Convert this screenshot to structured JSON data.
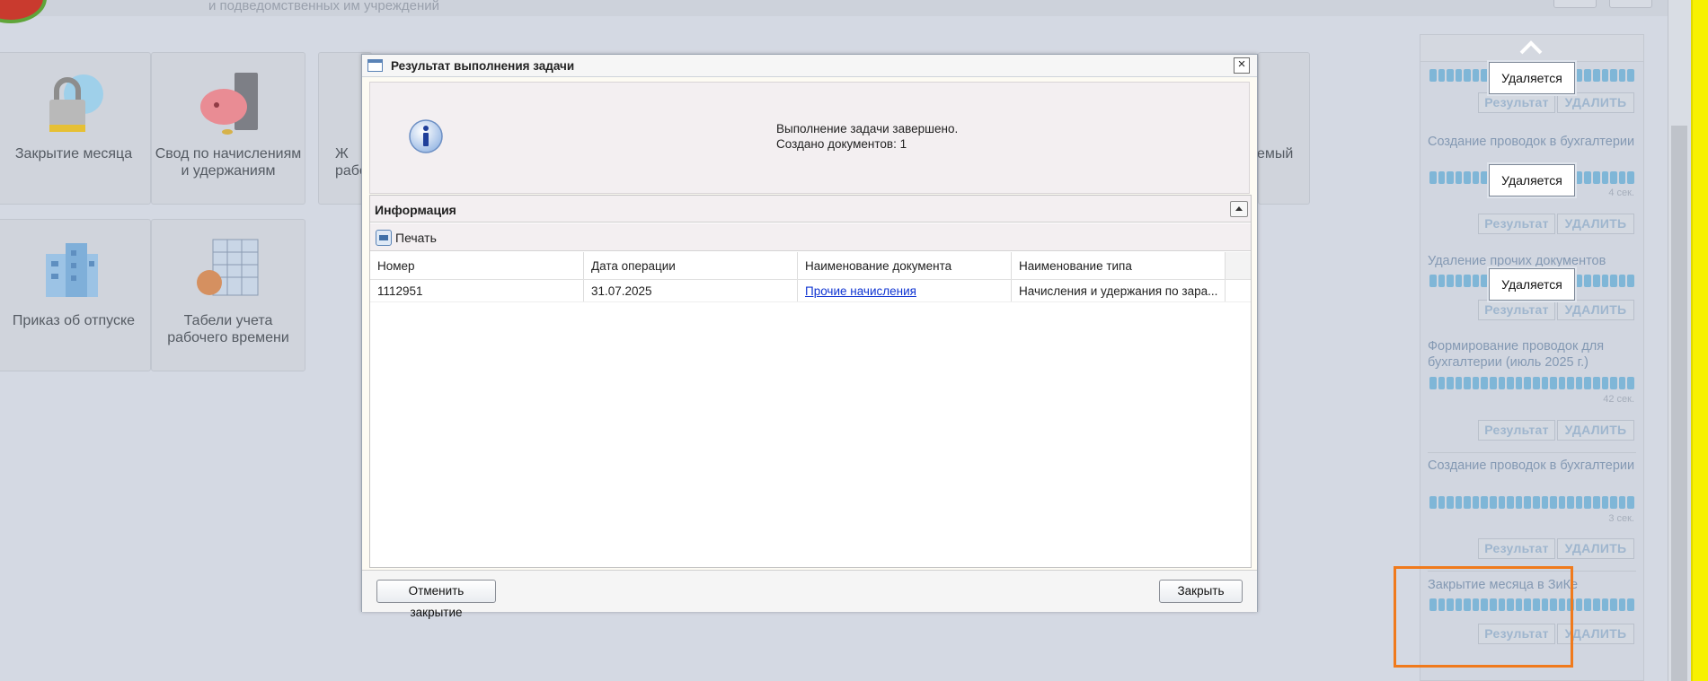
{
  "header": {
    "org_subtitle": "и подведомственных им учреждений"
  },
  "tiles": [
    {
      "label_line1": "Закрытие месяца",
      "label_line2": "",
      "icon": "lock-icon"
    },
    {
      "label_line1": "Свод по начислениям",
      "label_line2": "и удержаниям",
      "icon": "piggy-bank-icon"
    },
    {
      "label_line1": "Ж",
      "label_line2": "рабо",
      "icon": "journal-icon"
    },
    {
      "label_line1": "емый",
      "label_line2": "",
      "icon": "document-icon"
    },
    {
      "label_line1": "Приказ об отпуске",
      "label_line2": "",
      "icon": "building-icon"
    },
    {
      "label_line1": "Табели учета",
      "label_line2": "рабочего времени",
      "icon": "timesheet-icon"
    }
  ],
  "task_panel": {
    "deleting_label": "Удаляется",
    "result_label": "Результат",
    "delete_label": "УДАЛИТЬ",
    "tasks": [
      {
        "title": "",
        "time": ""
      },
      {
        "title": "Создание проводок в бухгалтерии",
        "time": "4 сек."
      },
      {
        "title": "Удаление прочих документов",
        "time": ""
      },
      {
        "title": "Формирование проводок для бухгалтерии (июль 2025 г.)",
        "time": "42 сек."
      },
      {
        "title": "Создание проводок в бухгалтерии",
        "time": "3 сек."
      },
      {
        "title": "Закрытие месяца в ЗиКе",
        "time": ""
      }
    ]
  },
  "modal": {
    "title": "Результат выполнения задачи",
    "close_symbol": "×",
    "message_line1": "Выполнение задачи завершено.",
    "message_line2": "Создано документов: 1",
    "info_title": "Информация",
    "print_label": "Печать",
    "columns": [
      "Номер",
      "Дата операции",
      "Наименование документа",
      "Наименование типа"
    ],
    "rows": [
      {
        "number": "1112951",
        "date": "31.07.2025",
        "doc_name": "Прочие начисления",
        "type_name": "Начисления и удержания по зара..."
      }
    ],
    "cancel_close_label": "Отменить закрытие",
    "close_label": "Закрыть"
  },
  "colors": {
    "accent_progress": "#7fb6d7",
    "highlight_border": "#f07a1c",
    "link": "#0f34d2"
  }
}
